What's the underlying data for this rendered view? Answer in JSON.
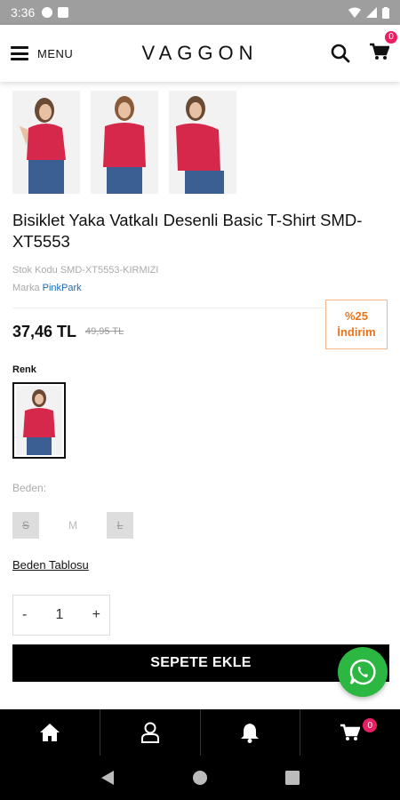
{
  "status_bar": {
    "time": "3:36"
  },
  "header": {
    "menu_label": "MENU",
    "logo": "VAGGON",
    "cart_count": "0"
  },
  "product": {
    "title": "Bisiklet Yaka Vatkalı Desenli Basic T-Shirt SMD-XT5553",
    "stock_label": "Stok Kodu",
    "stock_code": "SMD-XT5553-KIRMIZI",
    "brand_label": "Marka",
    "brand": "PinkPark",
    "price": "37,46 TL",
    "old_price": "49,95 TL",
    "discount_percent": "%25",
    "discount_label": "İndirim"
  },
  "color": {
    "label": "Renk"
  },
  "sizes": {
    "label": "Beden:",
    "options": [
      "S",
      "M",
      "L"
    ],
    "table_link": "Beden Tablosu"
  },
  "quantity": {
    "minus": "-",
    "value": "1",
    "plus": "+"
  },
  "add_to_cart": "SEPETE EKLE",
  "bottom_nav": {
    "cart_count": "0"
  },
  "colors": {
    "accent_pink": "#e91e63",
    "whatsapp_green": "#2bb741",
    "discount_orange": "#e8741c",
    "link_blue": "#1e6bb8"
  },
  "icons": [
    "menu-icon",
    "search-icon",
    "cart-icon",
    "home-icon",
    "user-icon",
    "bell-icon",
    "whatsapp-icon",
    "back-icon",
    "home-circle-icon",
    "recents-icon"
  ]
}
